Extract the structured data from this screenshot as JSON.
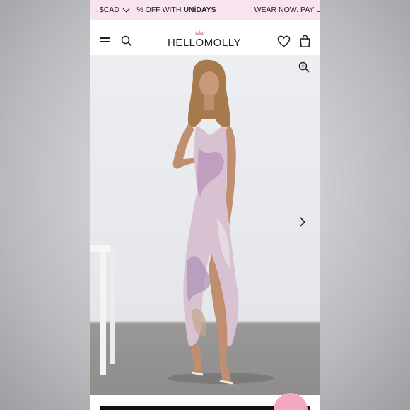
{
  "promo": {
    "currency": "$CAD",
    "message_prefix": "% OFF WITH ",
    "message_brand": "UNiDAYS",
    "message2": "WEAR NOW. PAY L"
  },
  "header": {
    "logo_text": "HELLOMOLLY"
  },
  "icons": [
    "chevron-down-icon",
    "menu-icon",
    "search-icon",
    "crown-icon",
    "heart-icon",
    "bag-icon",
    "zoom-in-icon",
    "chevron-right-icon"
  ],
  "colors": {
    "promo_bg": "#f8e4ee",
    "chat_button": "#f3a7c3",
    "dress_lilac": "#c9a6c8"
  }
}
